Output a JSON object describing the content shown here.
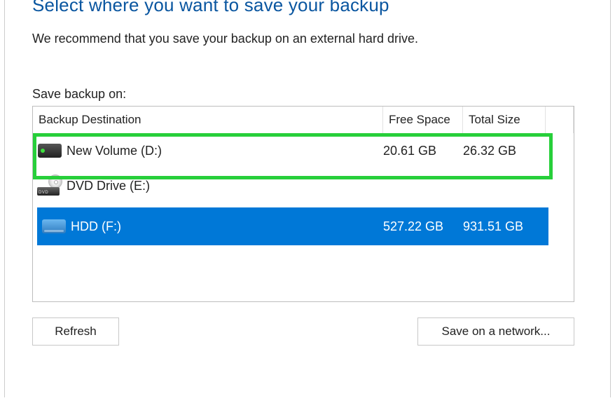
{
  "heading": "Select where you want to save your backup",
  "recommend": "We recommend that you save your backup on an external hard drive.",
  "save_label": "Save backup on:",
  "columns": {
    "destination": "Backup Destination",
    "free": "Free Space",
    "total": "Total Size"
  },
  "drives": [
    {
      "name": "New Volume (D:)",
      "free": "20.61 GB",
      "total": "26.32 GB",
      "icon": "drive-icon"
    },
    {
      "name": "DVD Drive (E:)",
      "free": "",
      "total": "",
      "icon": "dvd-icon"
    },
    {
      "name": "HDD (F:)",
      "free": "527.22 GB",
      "total": "931.51 GB",
      "icon": "drive-icon-blue",
      "selected": true
    }
  ],
  "buttons": {
    "refresh": "Refresh",
    "save_network": "Save on a network..."
  }
}
